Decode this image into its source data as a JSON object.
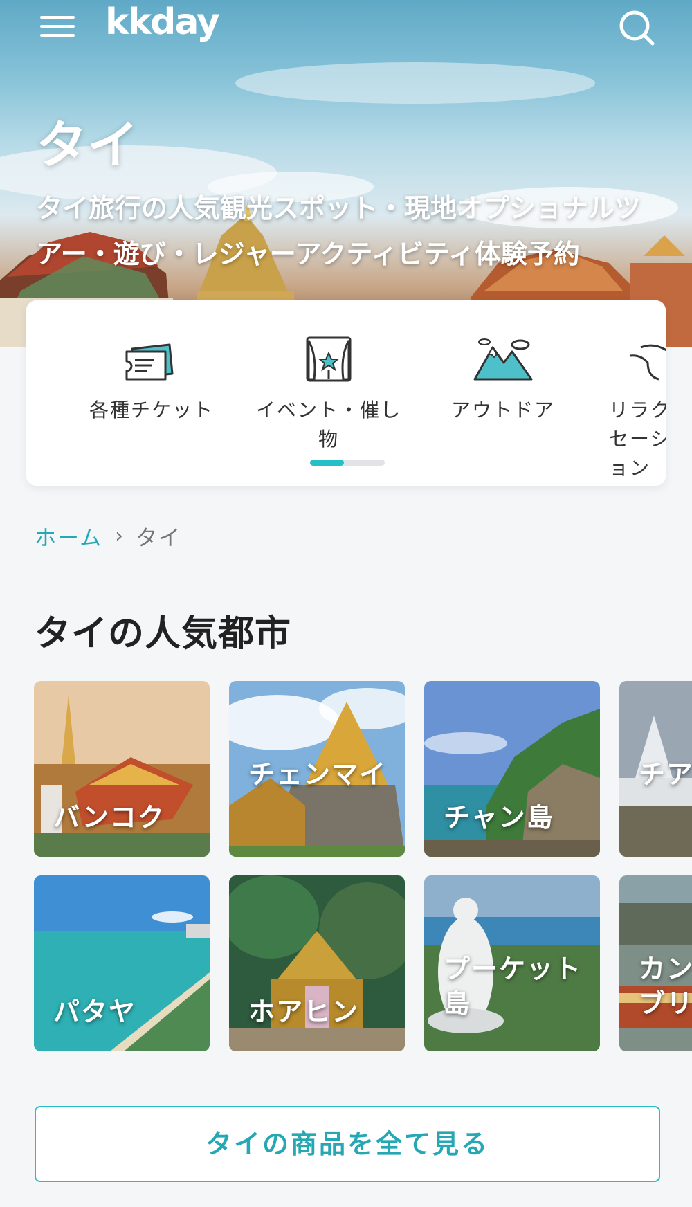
{
  "header": {
    "logo": "kkday",
    "menu_icon": "hamburger-menu-icon",
    "search_icon": "search-icon"
  },
  "hero": {
    "title": "タイ",
    "subtitle": "タイ旅行の人気観光スポット・現地オプショナルツアー・遊び・レジャーアクティビティ体験予約"
  },
  "categories": [
    {
      "label": "各種チケット",
      "icon": "ticket-icon"
    },
    {
      "label": "イベント・催し物",
      "icon": "theater-stage-icon"
    },
    {
      "label": "アウトドア",
      "icon": "mountain-icon"
    },
    {
      "label": "リラクセーション",
      "icon": "spa-icon"
    }
  ],
  "breadcrumb": {
    "home": "ホーム",
    "current": "タイ"
  },
  "section": {
    "title": "タイの人気都市"
  },
  "cities": [
    {
      "name": "バンコク"
    },
    {
      "name": "チェンマイ"
    },
    {
      "name": "チャン島"
    },
    {
      "name": "チアンライ"
    },
    {
      "name": "パタヤ"
    },
    {
      "name": "ホアヒン"
    },
    {
      "name": "プーケット島"
    },
    {
      "name": "カンチャナブリー"
    }
  ],
  "view_all_button": "タイの商品を全て見る",
  "colors": {
    "accent": "#26bec9",
    "accent_text": "#26a7b4",
    "background": "#f5f6f8"
  }
}
